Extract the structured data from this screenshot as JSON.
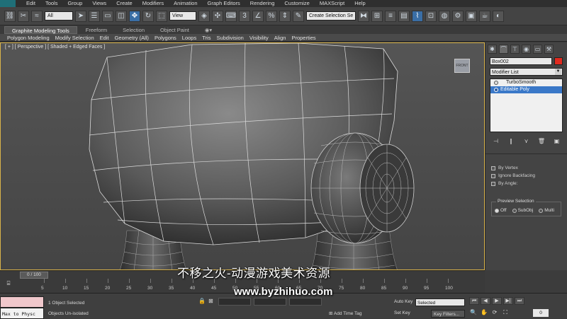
{
  "menu": {
    "items": [
      "Edit",
      "Tools",
      "Group",
      "Views",
      "Create",
      "Modifiers",
      "Animation",
      "Graph Editors",
      "Rendering",
      "Customize",
      "MAXScript",
      "Help"
    ]
  },
  "toolbar": {
    "selection_filter": "All",
    "ref_coord": "View",
    "named_selection": "Create Selection Se"
  },
  "ribbon": {
    "tabs": [
      "Graphite Modeling Tools",
      "Freeform",
      "Selection",
      "Object Paint"
    ],
    "sub_items": [
      "Polygon Modeling",
      "Modify Selection",
      "Edit",
      "Geometry (All)",
      "Polygons",
      "Loops",
      "Tris",
      "Subdivision",
      "Visibility",
      "Align",
      "Properties"
    ]
  },
  "viewport": {
    "label": "[ + ] [ Perspective ] [ Shaded + Edged Faces ]"
  },
  "command_panel": {
    "object_name": "Box002",
    "modifier_list": "Modifier List",
    "stack": [
      "TurboSmooth",
      "Editable Poly"
    ],
    "options": [
      "By Vertex",
      "Ignore Backfacing",
      "By Angle:"
    ],
    "preview_title": "Preview Selection",
    "preview_options": [
      "Off",
      "SubObj",
      "Multi"
    ]
  },
  "timeline": {
    "slider": "0 / 100",
    "ticks": [
      "5",
      "10",
      "15",
      "20",
      "25",
      "30",
      "35",
      "40",
      "45",
      "50",
      "55",
      "60",
      "65",
      "70",
      "75",
      "80",
      "85",
      "90",
      "95",
      "100"
    ]
  },
  "status": {
    "maxscript": "Max to Physc",
    "line1": "1 Object Selected",
    "line2": "Objects Un-isolated",
    "add_time_tag": "Add Time Tag",
    "auto_key": "Auto Key",
    "selected": "Selected",
    "set_key": "Set Key",
    "key_filters": "Key Filters..."
  },
  "watermark": {
    "chinese": "不移之火-动漫游戏美术资源",
    "url": "www.byzhihuo.com"
  }
}
